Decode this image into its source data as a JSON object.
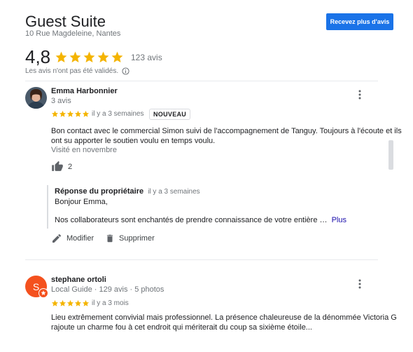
{
  "header": {
    "title": "Guest Suite",
    "address": "10 Rue Magdeleine, Nantes",
    "cta_label": "Recevez plus d'avis"
  },
  "summary": {
    "rating": "4,8",
    "stars": 5,
    "count": "123 avis",
    "unverified": "Les avis n'ont pas été validés."
  },
  "colors": {
    "star": "#f4b400",
    "accent": "#1a73e8",
    "link": "#1a0dab",
    "avatar2": "#f4511e"
  },
  "reviews": [
    {
      "name": "Emma Harbonnier",
      "sub": "3 avis",
      "stars": 5,
      "time": "il y a 3 semaines",
      "badge": "NOUVEAU",
      "text1": "Bon contact avec le commercial Simon suivi de l'accompagnement de Tanguy. Toujours à l'écoute et ils",
      "text2": "ont su apporter le soutien voulu en temps voulu.",
      "visited": "Visité en novembre",
      "likes": "2",
      "reply": {
        "owner": "Réponse du propriétaire",
        "time": "il y a 3 semaines",
        "line1": "Bonjour Emma,",
        "line2": "Nos collaborateurs sont enchantés de prendre connaissance de votre entière …",
        "more": "Plus"
      },
      "actions": {
        "edit": "Modifier",
        "delete": "Supprimer"
      }
    },
    {
      "name": "stephane ortoli",
      "avatar_letter": "S",
      "sub": "Local Guide · 129 avis · 5 photos",
      "stars": 5,
      "time": "il y a 3 mois",
      "text1": "Lieu extrêmement convivial mais professionnel. La présence chaleureuse de la dénommée Victoria G",
      "text2": "rajoute un charme fou à cet endroit qui mériterait du coup sa sixième étoile..."
    }
  ]
}
